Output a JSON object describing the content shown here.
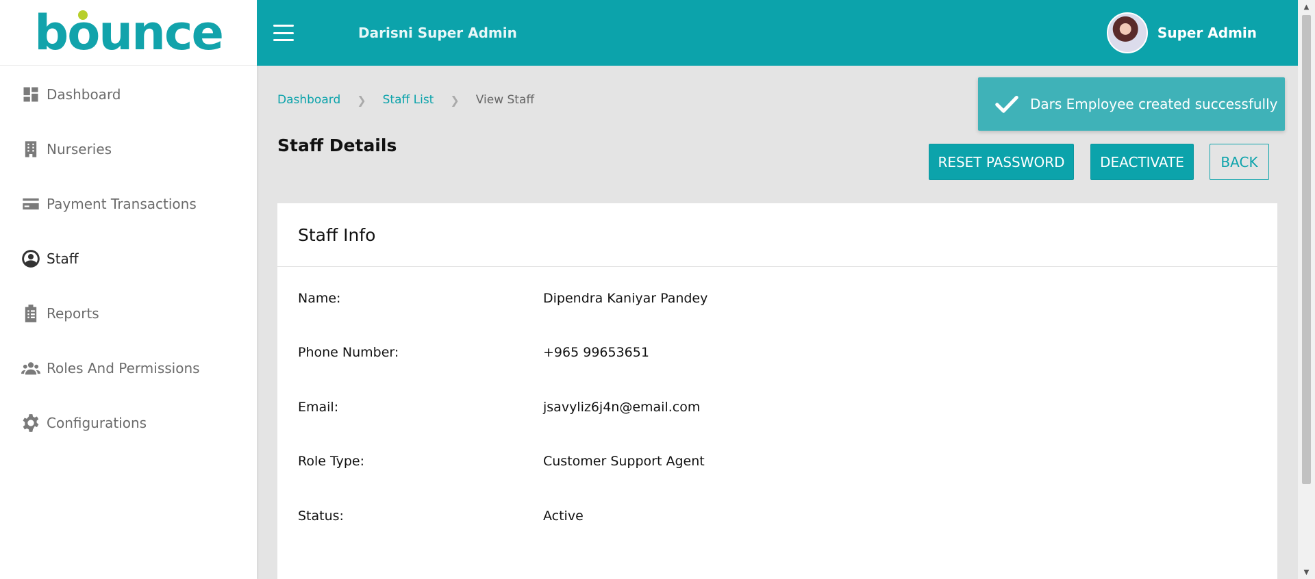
{
  "app": {
    "logo_text": "bounce"
  },
  "sidebar": {
    "items": [
      {
        "label": "Dashboard",
        "icon": "dashboard-icon"
      },
      {
        "label": "Nurseries",
        "icon": "building-icon"
      },
      {
        "label": "Payment Transactions",
        "icon": "credit-card-icon"
      },
      {
        "label": "Staff",
        "icon": "user-circle-icon",
        "active": true
      },
      {
        "label": "Reports",
        "icon": "clipboard-icon"
      },
      {
        "label": "Roles And Permissions",
        "icon": "users-group-icon"
      },
      {
        "label": "Configurations",
        "icon": "gear-icon"
      }
    ]
  },
  "header": {
    "title": "Darisni Super Admin",
    "user_name": "Super Admin",
    "accent_color": "#0ca3ab"
  },
  "breadcrumb": {
    "items": [
      "Dashboard",
      "Staff List",
      "View Staff"
    ]
  },
  "page": {
    "title": "Staff Details",
    "buttons": {
      "reset_password": "RESET PASSWORD",
      "deactivate": "DEACTIVATE",
      "back": "BACK"
    }
  },
  "toast": {
    "message": "Dars Employee created successfully",
    "icon": "check-icon"
  },
  "staff_info": {
    "title": "Staff Info",
    "fields": [
      {
        "label": "Name:",
        "value": "Dipendra Kaniyar Pandey"
      },
      {
        "label": "Phone Number:",
        "value": "+965 99653651"
      },
      {
        "label": "Email:",
        "value": "jsavyliz6j4n@email.com"
      },
      {
        "label": "Role Type:",
        "value": "Customer Support Agent"
      },
      {
        "label": "Status:",
        "value": "Active"
      }
    ]
  }
}
